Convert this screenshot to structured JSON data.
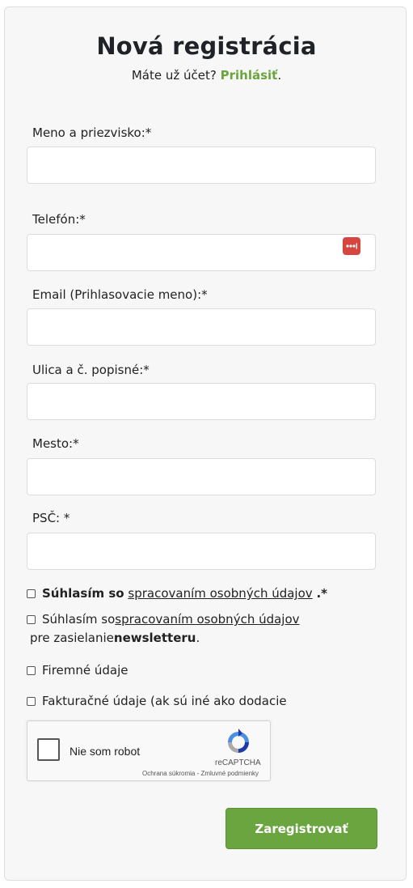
{
  "header": {
    "title": "Nová registrácia",
    "subtitle_prefix": "Máte už účet?",
    "login_link": "Prihlásiť",
    "subtitle_suffix": "."
  },
  "fields": {
    "name_label": "Meno a priezvisko:*",
    "phone_label": "Telefón:*",
    "email_label": "Email (Prihlasovacie meno):*",
    "street_label": "Ulica a č. popisné:*",
    "city_label": "Mesto:*",
    "zip_label": "PSČ: *",
    "name_value": "",
    "phone_value": "",
    "email_value": "",
    "street_value": "",
    "city_value": "",
    "zip_value": ""
  },
  "checkboxes": {
    "gdpr_bold": "Súhlasím so",
    "gdpr_link": "spracovaním osobných údajov",
    "gdpr_suffix": ".*",
    "newsletter_prefix": "Súhlasím so",
    "newsletter_link": "spracovaním osobných údajov",
    "newsletter_line2_prefix": "pre zasielanie",
    "newsletter_bold": "newsletteru",
    "newsletter_line2_suffix": ".",
    "company": "Firemné údaje",
    "billing": "Fakturačné údaje (ak sú iné ako dodacie"
  },
  "recaptcha": {
    "label": "Nie som robot",
    "brand": "reCAPTCHA",
    "privacy": "Ochrana súkromia",
    "separator": " - ",
    "terms": "Zmluvné podmienky"
  },
  "submit_label": "Zaregistrovať",
  "colors": {
    "accent": "#6aa53f",
    "password_icon": "#d6453f"
  }
}
